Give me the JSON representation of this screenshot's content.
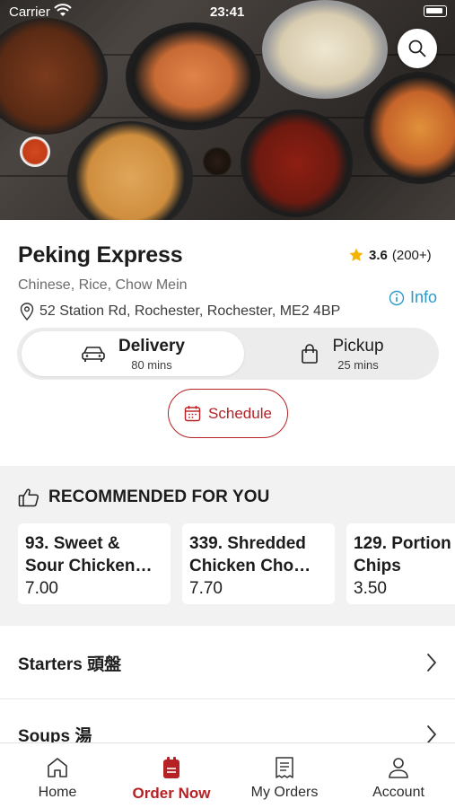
{
  "status_bar": {
    "carrier": "Carrier",
    "time": "23:41"
  },
  "restaurant": {
    "name": "Peking Express",
    "rating": "3.6",
    "rating_count": "(200+)",
    "cuisines": "Chinese, Rice, Chow Mein",
    "address": "52 Station Rd, Rochester, Rochester, ME2 4BP",
    "info_label": "Info"
  },
  "order_mode": {
    "selected": "delivery",
    "delivery": {
      "label": "Delivery",
      "time": "80 mins"
    },
    "pickup": {
      "label": "Pickup",
      "time": "25 mins"
    }
  },
  "schedule_label": "Schedule",
  "recommended": {
    "heading": "RECOMMENDED FOR YOU",
    "items": [
      {
        "title": "93. Sweet &\nSour Chicken…",
        "price": "7.00"
      },
      {
        "title": "339. Shredded\nChicken Cho…",
        "price": "7.70"
      },
      {
        "title": "129. Portion\nChips",
        "price": "3.50"
      }
    ]
  },
  "menu_categories": [
    {
      "label": "Starters 頭盤"
    },
    {
      "label": "Soups 湯"
    }
  ],
  "tab_bar": {
    "active": "order_now",
    "items": [
      {
        "label": "Home",
        "icon": "home-icon"
      },
      {
        "label": "Order Now",
        "icon": "bag-icon"
      },
      {
        "label": "My Orders",
        "icon": "receipt-icon"
      },
      {
        "label": "Account",
        "icon": "person-icon"
      }
    ]
  },
  "colors": {
    "brand": "#b52125",
    "info": "#2a9ac7",
    "star": "#f5b301",
    "section_bg": "#f2f2f2"
  }
}
